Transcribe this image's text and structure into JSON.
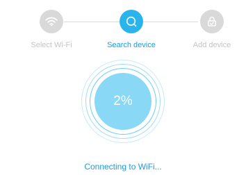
{
  "steps": [
    {
      "label": "Select Wi-Fi",
      "icon": "wifi-icon",
      "state": "done"
    },
    {
      "label": "Search device",
      "icon": "search-icon",
      "state": "active"
    },
    {
      "label": "Add device",
      "icon": "lock-icon",
      "state": "pending"
    }
  ],
  "progress": {
    "percent_label": "2%",
    "value": 0.02
  },
  "status_text": "Connecting to WiFi...",
  "colors": {
    "accent": "#29b5ec",
    "accent_text": "#1a9be0",
    "inactive": "#d9d9d9",
    "disc": "#88d8f6"
  }
}
